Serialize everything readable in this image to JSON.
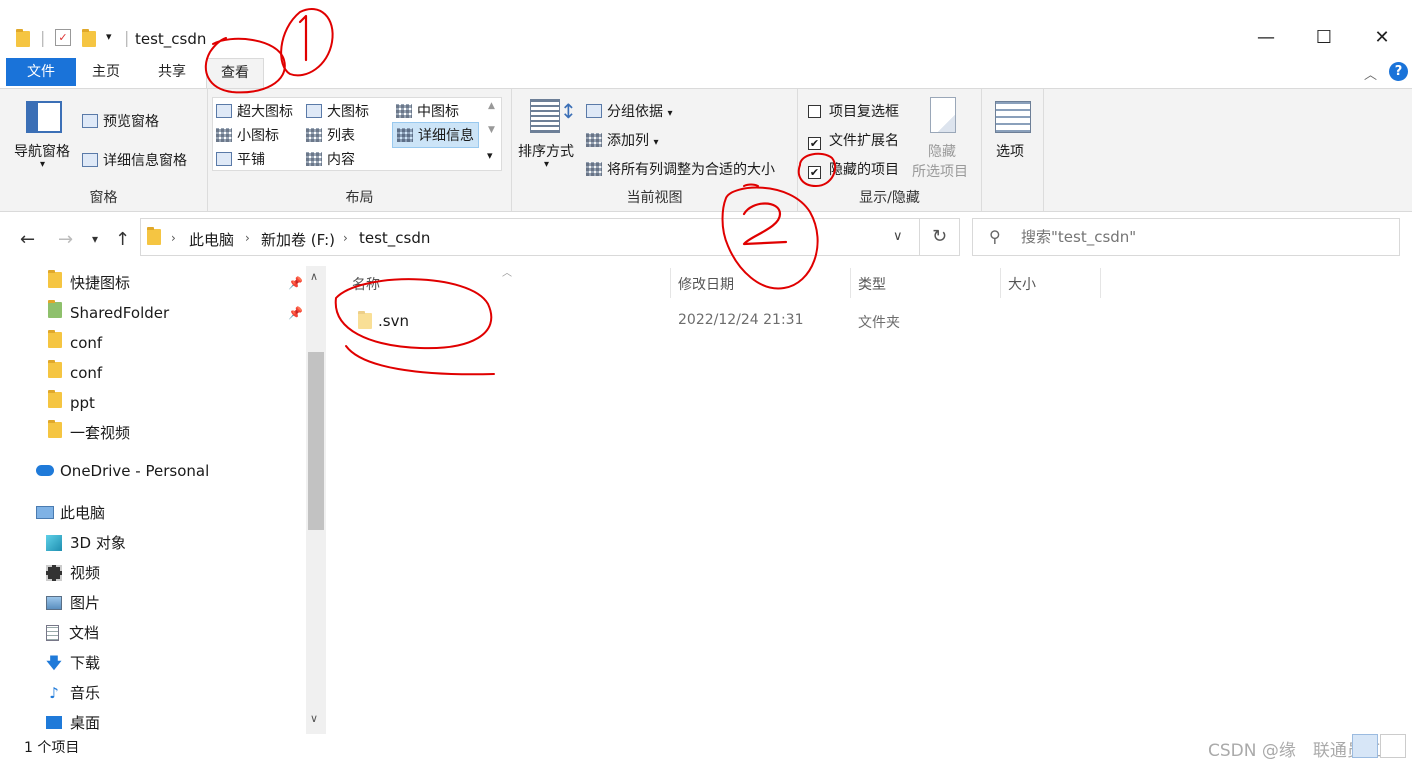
{
  "window": {
    "title": "test_csdn",
    "minimize": "—",
    "maximize": "☐",
    "close": "✕"
  },
  "tabs": {
    "file": "文件",
    "home": "主页",
    "share": "共享",
    "view": "查看"
  },
  "ribbon": {
    "pane": {
      "nav_pane": "导航窗格",
      "preview_pane": "预览窗格",
      "details_pane": "详细信息窗格",
      "label": "窗格"
    },
    "layout": {
      "extra_large": "超大图标",
      "large": "大图标",
      "medium": "中图标",
      "small": "小图标",
      "list": "列表",
      "details": "详细信息",
      "tiles": "平铺",
      "content": "内容",
      "label": "布局"
    },
    "current_view": {
      "sort": "排序方式",
      "group_by": "分组依据",
      "add_column": "添加列",
      "fit_columns": "将所有列调整为合适的大小",
      "label": "当前视图"
    },
    "show_hide": {
      "item_checkboxes": "项目复选框",
      "file_extensions": "文件扩展名",
      "hidden_items": "隐藏的项目",
      "hide_selected_1": "隐藏",
      "hide_selected_2": "所选项目",
      "label": "显示/隐藏",
      "item_checkboxes_checked": false,
      "file_extensions_checked": true,
      "hidden_items_checked": true
    },
    "options": "选项"
  },
  "address": {
    "crumbs": [
      "此电脑",
      "新加卷 (F:)",
      "test_csdn"
    ],
    "search_placeholder": "搜索\"test_csdn\""
  },
  "sidebar": {
    "items": [
      {
        "label": "快捷图标",
        "pinned": true
      },
      {
        "label": "SharedFolder",
        "pinned": true
      },
      {
        "label": "conf"
      },
      {
        "label": "conf"
      },
      {
        "label": "ppt"
      },
      {
        "label": "一套视频"
      },
      {
        "label": "OneDrive - Personal"
      },
      {
        "label": "此电脑"
      },
      {
        "label": "3D 对象"
      },
      {
        "label": "视频"
      },
      {
        "label": "图片"
      },
      {
        "label": "文档"
      },
      {
        "label": "下载"
      },
      {
        "label": "音乐"
      },
      {
        "label": "桌面"
      }
    ]
  },
  "filelist": {
    "columns": [
      "名称",
      "修改日期",
      "类型",
      "大小"
    ],
    "rows": [
      {
        "name": ".svn",
        "modified": "2022/12/24 21:31",
        "type": "文件夹",
        "size": ""
      }
    ]
  },
  "status": {
    "count": "1 个项目",
    "watermark": "CSDN @缘　联通员工"
  },
  "annotations": [
    "①",
    "②"
  ],
  "colors": {
    "accent": "#1a73d9",
    "annotation": "#e00000",
    "ribbon_bg": "#f3f3f3"
  }
}
